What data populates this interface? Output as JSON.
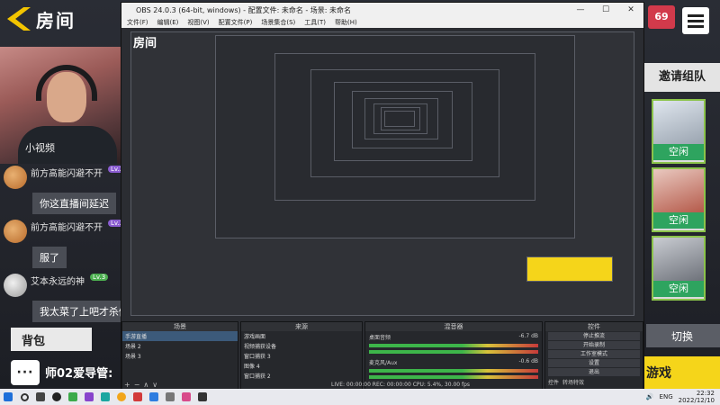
{
  "game": {
    "room_title": "房间",
    "webcam_watermark": "小视频",
    "chat": [
      {
        "name": "前方高能闪避不开",
        "level": "Lv.22",
        "message": "你这直播间延迟"
      },
      {
        "name": "前方高能闪避不开",
        "level": "Lv.22",
        "message": "服了"
      },
      {
        "name": "艾本永远的神",
        "level": "Lv.3",
        "message": "我太菜了上吧才杀俩"
      }
    ],
    "bag_label": "背包",
    "mentor_label": "师02爱导管:",
    "badge_count": "69",
    "invite_label": "邀请组队",
    "slot_status": [
      "空闲",
      "空闲",
      "空闲"
    ],
    "switch_label": "切换",
    "play_label": "游戏"
  },
  "obs": {
    "window_title": "OBS 24.0.3 (64-bit, windows) - 配置文件: 未命名 - 场景: 未命名",
    "menu": [
      "文件(F)",
      "编辑(E)",
      "视图(V)",
      "配置文件(P)",
      "场景集合(S)",
      "工具(T)",
      "帮助(H)"
    ],
    "window_controls": [
      "—",
      "☐",
      "✕"
    ],
    "docks": {
      "scenes": {
        "title": "场景",
        "items": [
          "手游直播",
          "场景 2",
          "场景 3"
        ]
      },
      "sources": {
        "title": "来源",
        "items": [
          "游戏画面",
          "视频捕获设备",
          "窗口捕获 3",
          "图像 4",
          "窗口捕获 2"
        ]
      },
      "mixer": {
        "title": "混音器",
        "channels": [
          {
            "name": "桌面音频",
            "db": "-6.7 dB"
          },
          {
            "name": "麦克风/Aux",
            "db": "-0.6 dB"
          }
        ]
      },
      "controls": {
        "title": "控件",
        "buttons": [
          "停止推流",
          "开始录制",
          "工作室模式",
          "设置",
          "退出"
        ],
        "tabs": [
          "控件",
          "转场特效"
        ]
      }
    },
    "status": "LIVE: 00:00:00   REC: 00:00:00   CPU: 5.4%, 30.00 fps"
  },
  "taskbar": {
    "tray_lang": "ENG",
    "time": "22:32",
    "date": "2022/12/10"
  },
  "colors": {
    "accent_yellow": "#f2c400",
    "play_yellow": "#f5d51a",
    "status_green": "#2ea45f",
    "badge_red": "#d23a4b"
  }
}
